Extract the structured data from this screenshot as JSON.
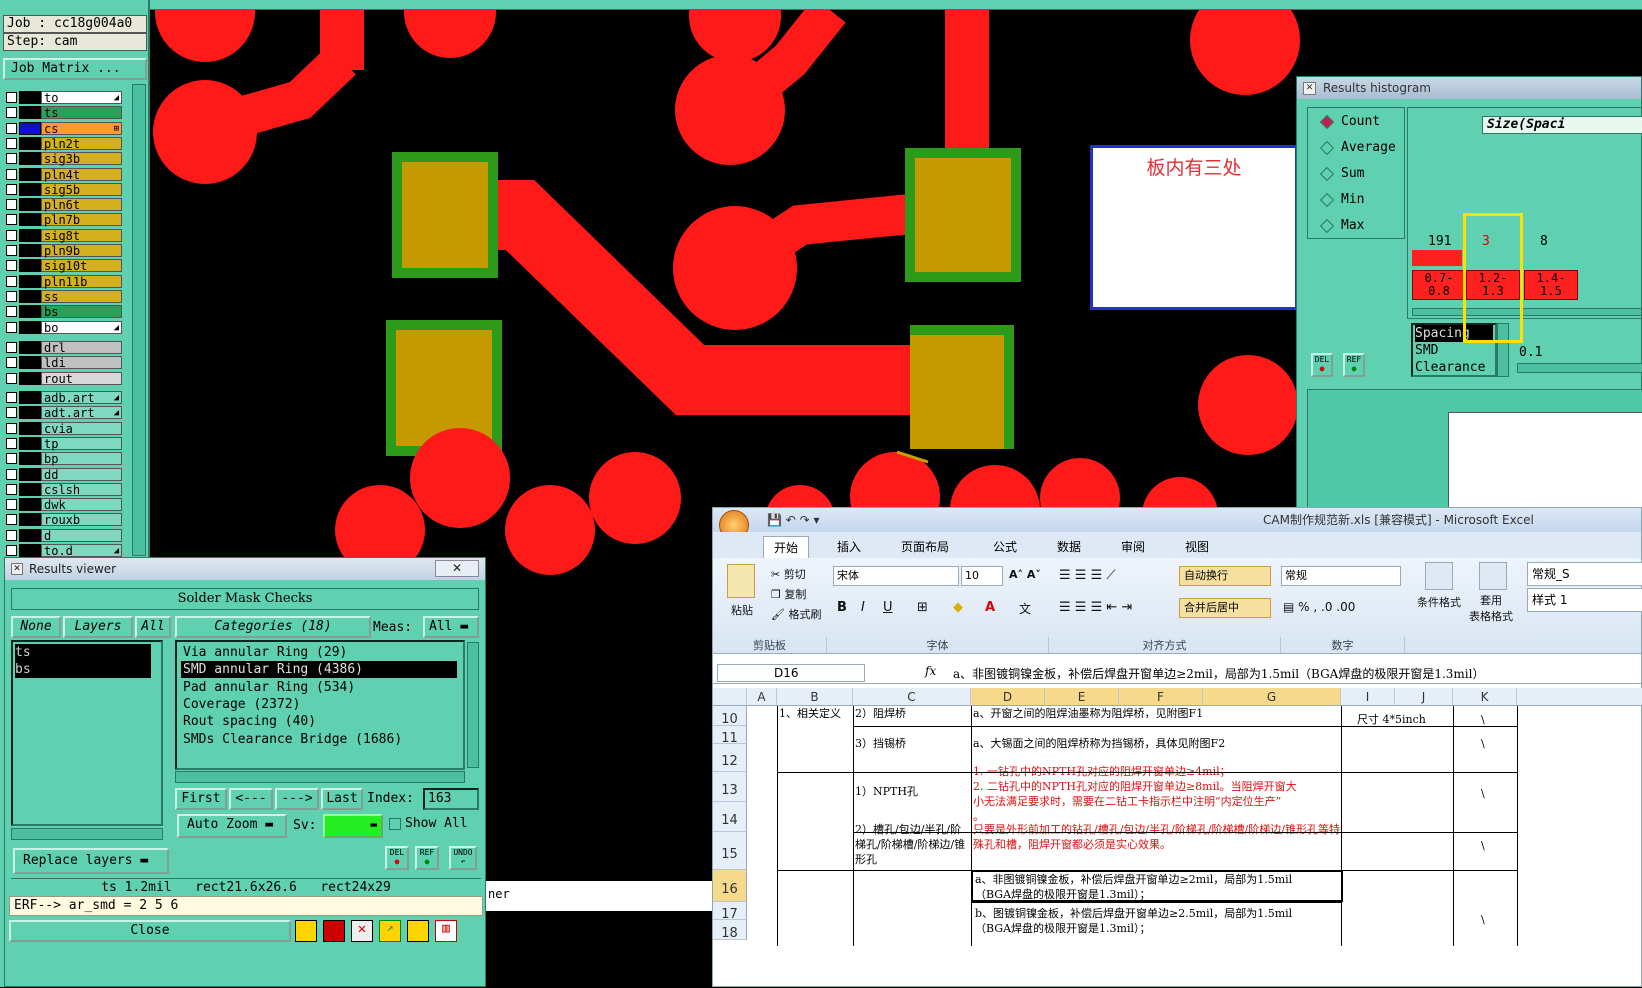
{
  "top_bar": {},
  "left_panel": {
    "job_label": "Job : cc18g004a0",
    "step_label": "Step: cam",
    "job_matrix_button": "Job Matrix ...",
    "layers": [
      {
        "name": "to",
        "color": "#ffffff",
        "swatch": "#000000"
      },
      {
        "name": "ts",
        "color": "#2aa05a",
        "swatch": "#000000"
      },
      {
        "name": "cs",
        "color": "#ff9a33",
        "swatch": "#1010cc"
      },
      {
        "name": "pln2t",
        "color": "#d4b020",
        "swatch": "#000000"
      },
      {
        "name": "sig3b",
        "color": "#d4b020",
        "swatch": "#000000"
      },
      {
        "name": "pln4t",
        "color": "#d4b020",
        "swatch": "#000000"
      },
      {
        "name": "sig5b",
        "color": "#d4b020",
        "swatch": "#000000"
      },
      {
        "name": "pln6t",
        "color": "#d4b020",
        "swatch": "#000000"
      },
      {
        "name": "pln7b",
        "color": "#d4b020",
        "swatch": "#000000"
      },
      {
        "name": "sig8t",
        "color": "#d4b020",
        "swatch": "#000000"
      },
      {
        "name": "pln9b",
        "color": "#d4b020",
        "swatch": "#000000"
      },
      {
        "name": "sig10t",
        "color": "#d4b020",
        "swatch": "#000000"
      },
      {
        "name": "pln11b",
        "color": "#d4b020",
        "swatch": "#000000"
      },
      {
        "name": "ss",
        "color": "#d4b020",
        "swatch": "#000000"
      },
      {
        "name": "bs",
        "color": "#2aa05a",
        "swatch": "#000000"
      },
      {
        "name": "bo",
        "color": "#ffffff",
        "swatch": "#000000"
      }
    ],
    "layers2": [
      {
        "name": "drl",
        "color": "#c0c0c0"
      },
      {
        "name": "ldi",
        "color": "#c0c0c0"
      },
      {
        "name": "rout",
        "color": "#d8d8d8"
      }
    ],
    "layers3": [
      {
        "name": "adb.art",
        "color": "#7fd8c0"
      },
      {
        "name": "adt.art",
        "color": "#7fd8c0"
      },
      {
        "name": "cvia",
        "color": "#7fd8c0"
      },
      {
        "name": "tp",
        "color": "#7fd8c0"
      },
      {
        "name": "bp",
        "color": "#7fd8c0"
      },
      {
        "name": "dd",
        "color": "#7fd8c0"
      },
      {
        "name": "cslsh",
        "color": "#7fd8c0"
      },
      {
        "name": "dwk",
        "color": "#7fd8c0"
      },
      {
        "name": "rouxb",
        "color": "#7fd8c0"
      },
      {
        "name": "d",
        "color": "#7fd8c0"
      },
      {
        "name": "to.d",
        "color": "#7fd8c0"
      }
    ]
  },
  "annotation": {
    "text": "板内有三处"
  },
  "histogram": {
    "title": "Results histogram",
    "options": [
      "Count",
      "Average",
      "Sum",
      "Min",
      "Max"
    ],
    "selected": "Count",
    "size_label": "Size(Spaci",
    "bins": [
      {
        "count": "191",
        "label1": "0.7-",
        "label2": "0.8"
      },
      {
        "count": "3",
        "label1": "1.2-",
        "label2": "1.3"
      },
      {
        "count": "8",
        "label1": "1.4-",
        "label2": "1.5"
      }
    ],
    "list": [
      "Spacing",
      "SMD",
      "Clearance"
    ],
    "value": "0.1",
    "del_label": "DEL",
    "ref_label": "REF"
  },
  "results_viewer": {
    "title": "Results viewer",
    "header": "Solder Mask Checks",
    "none_label": "None",
    "layers_label": "Layers",
    "all_label": "All",
    "categories_label": "Categories (18)",
    "meas_label": "Meas:",
    "meas_value": "All",
    "layer_list": [
      "ts",
      "bs"
    ],
    "categories": [
      "Via annular Ring (29)",
      "SMD annular Ring (4386)",
      "Pad annular Ring (534)",
      "Coverage (2372)",
      "Rout spacing (40)",
      "SMDs Clearance Bridge (1686)"
    ],
    "selected_category": "SMD annular Ring (4386)",
    "first_label": "First",
    "prev_label": "<---",
    "next_label": "--->",
    "last_label": "Last",
    "index_label": "Index:",
    "index_value": "163",
    "auto_zoom_label": "Auto Zoom",
    "sv_label": "Sv:",
    "show_all_label": "Show All",
    "replace_layers_label": "Replace layers",
    "del_label": "DEL",
    "ref_label": "REF",
    "undo_label": "UNDO",
    "status_line": "ts 1.2mil   rect21.6x26.6   rect24x29",
    "erf_line": "ERF--> ar_smd = 2 5 6",
    "close_label": "Close",
    "behind_text": "ner"
  },
  "excel": {
    "title": "CAM制作规范新.xls [兼容模式] - Microsoft Excel",
    "tabs": [
      "开始",
      "插入",
      "页面布局",
      "公式",
      "数据",
      "审阅",
      "视图"
    ],
    "active_tab": "开始",
    "clipboard": {
      "paste": "粘贴",
      "cut": "剪切",
      "copy": "复制",
      "format_painter": "格式刷",
      "group": "剪贴板"
    },
    "font": {
      "name": "宋体",
      "size": "10",
      "group": "字体"
    },
    "align": {
      "wrap": "自动换行",
      "merge": "合并后居中",
      "group": "对齐方式"
    },
    "number": {
      "format": "常规",
      "group": "数字"
    },
    "styles": {
      "cond": "条件格式",
      "table": "套用\n表格格式",
      "normal": "常规_S",
      "style1": "样式 1"
    },
    "name_box": "D16",
    "fx": "fx",
    "formula_text": "a、非图镀铜镍金板，补偿后焊盘开窗单边≥2mil，局部为1.5mil（BGA焊盘的极限开窗是1.3mil）",
    "columns": [
      "A",
      "B",
      "C",
      "D",
      "E",
      "F",
      "G",
      "I",
      "J",
      "K"
    ],
    "rows": [
      "10",
      "11",
      "12",
      "13",
      "14",
      "15",
      "16",
      "17",
      "18"
    ],
    "cells": {
      "b10": "1、相关定义",
      "c10": "2）阻焊桥",
      "d10": "a、开窗之间的阻焊油墨称为阻焊桥，见附图F1",
      "i10": "尺寸 4*5inch",
      "k10": "\\",
      "c12": "3）挡锡桥",
      "d12": "a、大锡面之间的阻焊桥称为挡锡桥，具体见附图F2",
      "k12": "\\",
      "c13": "1）NPTH孔",
      "d13a": "1. 一钻孔中的NPTH孔对应的阻焊开窗单边≥4mil；",
      "d13b": "2. 二钻孔中的NPTH孔对应的阻焊开窗单边≥8mil。当阻焊开窗大",
      "d13c": "小无法满足要求时，需要在二钻工卡指示栏中注明“内定位生产”",
      "d13d": "。",
      "k13": "\\",
      "c15": "2）槽孔/包边/半孔/阶梯孔/阶梯槽/阶梯边/锥形孔",
      "d15": "只要是外形前加工的钻孔/槽孔/包边/半孔/阶梯孔/阶梯槽/阶梯边/锥形孔等特殊孔和槽，阻焊开窗都必须是实心效果。",
      "k15": "\\",
      "d16a": "a、非图镀铜镍金板，补偿后焊盘开窗单边≥2mil，局部为1.5mil",
      "d16b": "（BGA焊盘的极限开窗是1.3mil）；",
      "d17a": "b、图镀铜镍金板，补偿后焊盘开窗单边≥2.5mil，局部为1.5mil",
      "d17b": "（BGA焊盘的极限开窗是1.3mil）；",
      "k17": "\\"
    }
  }
}
